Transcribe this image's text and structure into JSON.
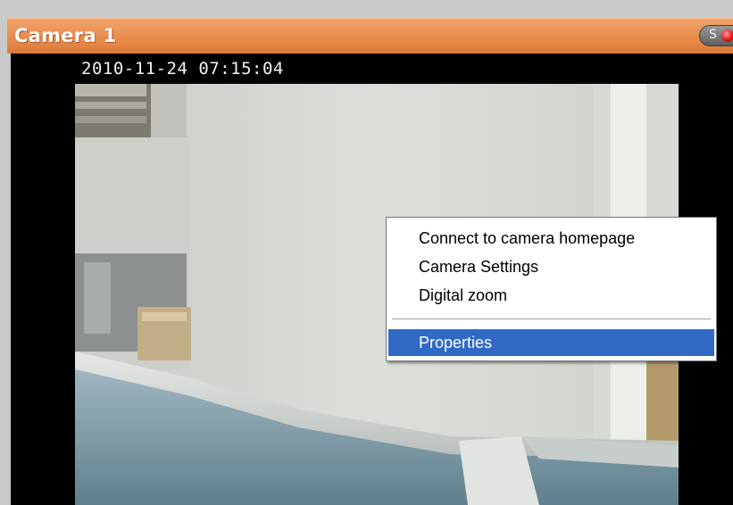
{
  "window": {
    "title": "Camera 1"
  },
  "status": {
    "indicator_letter": "S",
    "icon": "record-indicator-icon",
    "record_color": "#e01a1a"
  },
  "video": {
    "timestamp": "2010-11-24 07:15:04"
  },
  "context_menu": {
    "items": [
      {
        "label": "Connect to camera homepage"
      },
      {
        "label": "Camera Settings"
      },
      {
        "label": "Digital zoom"
      },
      {
        "label": "Properties",
        "selected": true
      }
    ]
  },
  "colors": {
    "titlebar": "#e88c4c",
    "menu_highlight": "#316ac5"
  }
}
